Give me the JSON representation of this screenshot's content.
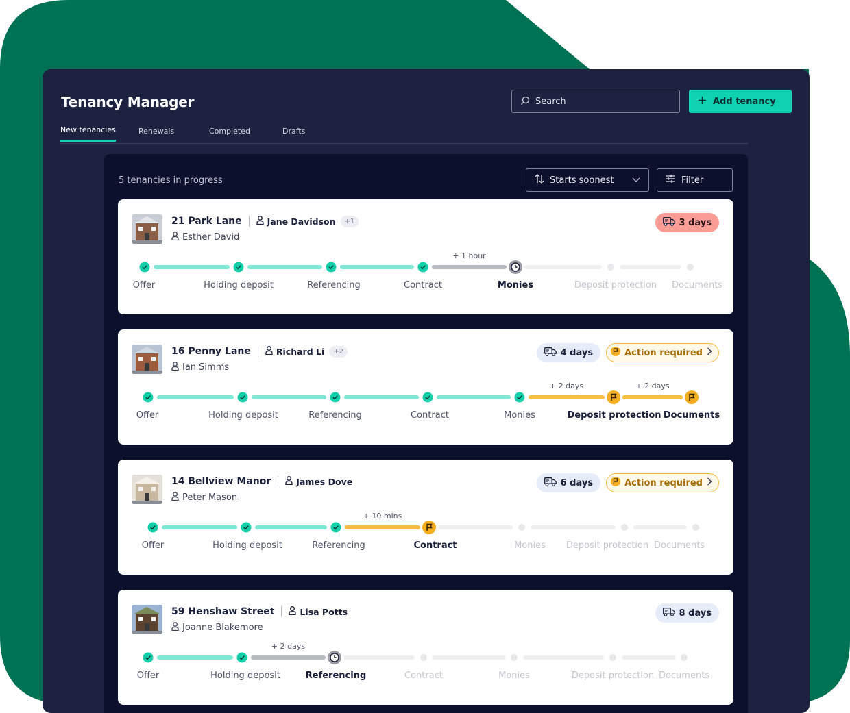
{
  "app": {
    "title": "Tenancy Manager"
  },
  "search": {
    "placeholder": "Search"
  },
  "add_button": {
    "label": "Add tenancy"
  },
  "tabs": [
    {
      "label": "New tenancies",
      "active": true
    },
    {
      "label": "Renewals",
      "active": false
    },
    {
      "label": "Completed",
      "active": false
    },
    {
      "label": "Drafts",
      "active": false
    }
  ],
  "panel": {
    "count_text": "5 tenancies in progress",
    "sort_label": "Starts soonest",
    "filter_label": "Filter"
  },
  "colors": {
    "accent": "#0fd3b0",
    "background_green": "#007254",
    "window": "#1c2240",
    "panel": "#0b112c",
    "warning": "#f5ad22",
    "urgent": "#fb9c95"
  },
  "tenancies": [
    {
      "address": "21 Park Lane",
      "tenant": "Jane Davidson",
      "extra": "+1",
      "agent": "Esther David",
      "days": "3 days",
      "days_style": "urgent",
      "action": null,
      "stages": [
        {
          "label": "Offer",
          "status": "done"
        },
        {
          "label": "Holding deposit",
          "status": "done"
        },
        {
          "label": "Referencing",
          "status": "done"
        },
        {
          "label": "Contract",
          "status": "done"
        },
        {
          "label": "Monies",
          "status": "waiting",
          "delay": "+ 1 hour"
        },
        {
          "label": "Deposit protection",
          "status": "pending"
        },
        {
          "label": "Documents",
          "status": "pending"
        }
      ]
    },
    {
      "address": "16 Penny Lane",
      "tenant": "Richard Li",
      "extra": "+2",
      "agent": "Ian Simms",
      "days": "4 days",
      "days_style": "normal",
      "action": "Action required",
      "stages": [
        {
          "label": "Offer",
          "status": "done"
        },
        {
          "label": "Holding deposit",
          "status": "done"
        },
        {
          "label": "Referencing",
          "status": "done"
        },
        {
          "label": "Contract",
          "status": "done"
        },
        {
          "label": "Monies",
          "status": "done"
        },
        {
          "label": "Deposit protection",
          "status": "action",
          "delay": "+ 2 days"
        },
        {
          "label": "Documents",
          "status": "action",
          "delay": "+ 2 days"
        }
      ]
    },
    {
      "address": "14 Bellview Manor",
      "tenant": "James Dove",
      "extra": null,
      "agent": "Peter Mason",
      "days": "6 days",
      "days_style": "normal",
      "action": "Action required",
      "stages": [
        {
          "label": "Offer",
          "status": "done"
        },
        {
          "label": "Holding deposit",
          "status": "done"
        },
        {
          "label": "Referencing",
          "status": "done"
        },
        {
          "label": "Contract",
          "status": "action",
          "delay": "+ 10 mins"
        },
        {
          "label": "Monies",
          "status": "pending"
        },
        {
          "label": "Deposit protection",
          "status": "pending"
        },
        {
          "label": "Documents",
          "status": "pending"
        }
      ]
    },
    {
      "address": "59 Henshaw Street",
      "tenant": "Lisa Potts",
      "extra": null,
      "agent": "Joanne Blakemore",
      "days": "8 days",
      "days_style": "normal",
      "action": null,
      "stages": [
        {
          "label": "Offer",
          "status": "done"
        },
        {
          "label": "Holding deposit",
          "status": "done"
        },
        {
          "label": "Referencing",
          "status": "waiting",
          "delay": "+ 2 days"
        },
        {
          "label": "Contract",
          "status": "pending"
        },
        {
          "label": "Monies",
          "status": "pending"
        },
        {
          "label": "Deposit protection",
          "status": "pending"
        },
        {
          "label": "Documents",
          "status": "pending"
        }
      ]
    }
  ]
}
